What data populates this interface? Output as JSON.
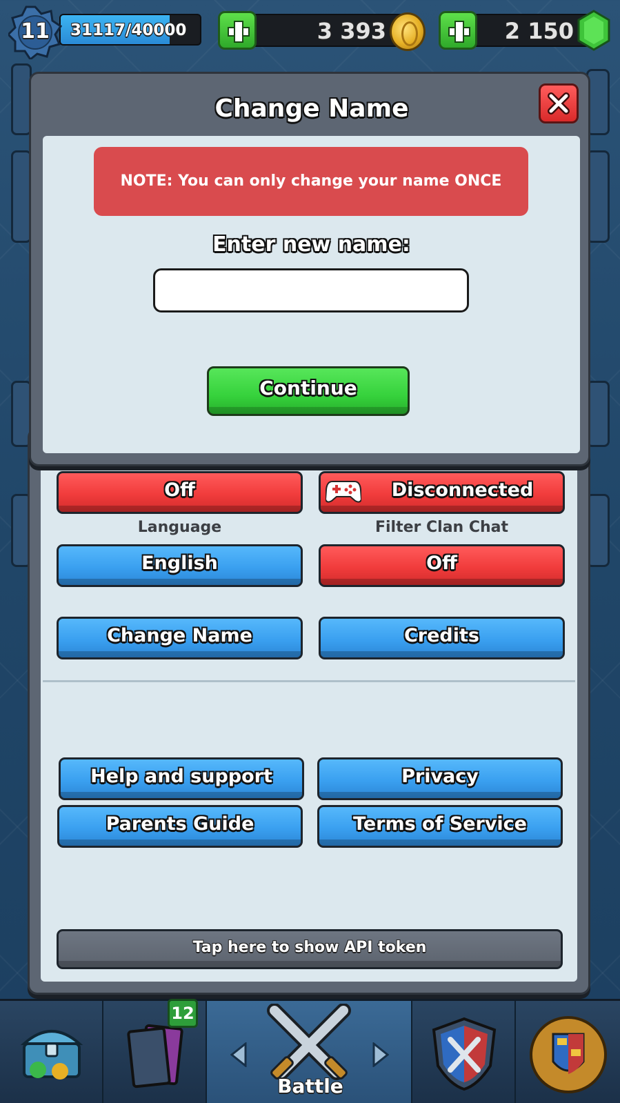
{
  "topbar": {
    "level": "11",
    "xp_text": "31117/40000",
    "xp_progress": 0.78,
    "gold": "3 393",
    "gems": "2 150"
  },
  "modal": {
    "title": "Change Name",
    "note": "NOTE: You can only change your name ONCE",
    "enter_label": "Enter new name:",
    "input_value": "",
    "continue_label": "Continue"
  },
  "settings": {
    "row1_left": "Off",
    "row1_right": "Disconnected",
    "language_label": "Language",
    "language_value": "English",
    "filter_label": "Filter Clan Chat",
    "filter_value": "Off",
    "change_name": "Change Name",
    "credits": "Credits",
    "help_support": "Help and support",
    "privacy": "Privacy",
    "parents_guide": "Parents Guide",
    "terms": "Terms of Service",
    "api_token": "Tap here to show API token"
  },
  "bottom_nav": {
    "cards_badge": "12",
    "battle_label": "Battle"
  },
  "colors": {
    "blue_button": "#3aa0f0",
    "red_button": "#f13c3c",
    "green_button": "#36d23c",
    "note_red": "#d94b4e",
    "panel_light": "#dce8ee",
    "panel_frame": "#5d6673"
  }
}
